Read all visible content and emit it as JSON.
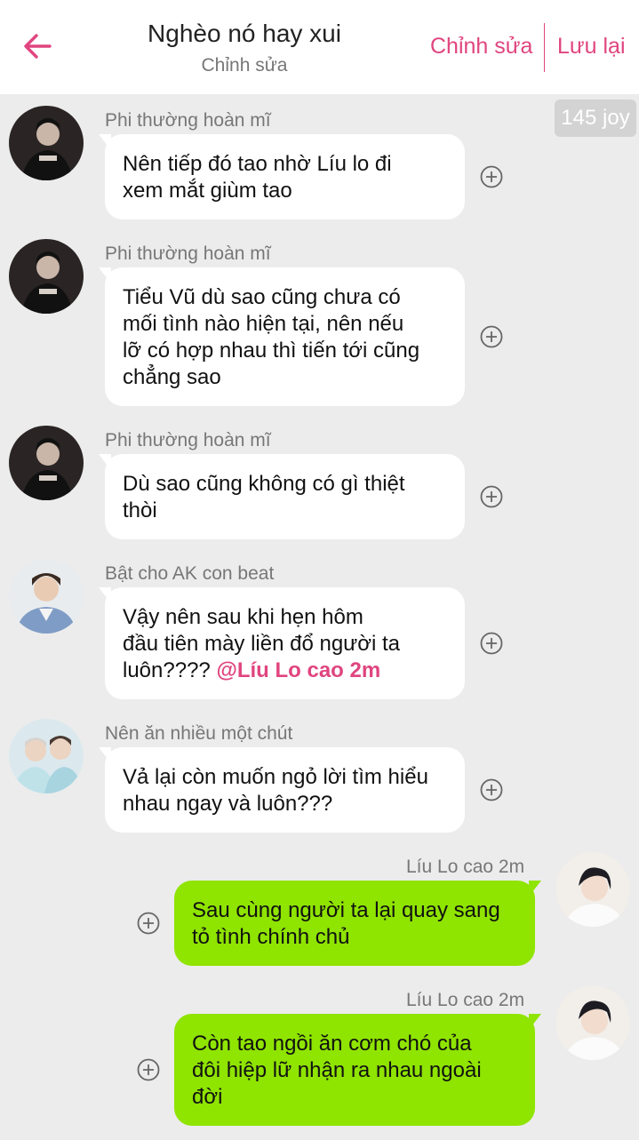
{
  "header": {
    "title": "Nghèo nó hay xui",
    "subtitle": "Chỉnh sửa",
    "edit_label": "Chỉnh sửa",
    "save_label": "Lưu lại",
    "back_icon": "arrow-left-icon",
    "accent_color": "#e0457f"
  },
  "joy_badge": "145 joy",
  "messages": [
    {
      "sender": "Phi thường hoàn mĩ",
      "side": "left",
      "lines": [
        "Nên tiếp đó tao nhờ Líu lo đi",
        "xem mắt giùm tao"
      ]
    },
    {
      "sender": "Phi thường hoàn mĩ",
      "side": "left",
      "lines": [
        "Tiểu Vũ dù sao cũng chưa có",
        "mối tình nào hiện tại, nên nếu",
        "lỡ có hợp nhau thì tiến tới cũng",
        "chẳng sao"
      ]
    },
    {
      "sender": "Phi thường hoàn mĩ",
      "side": "left",
      "lines": [
        "Dù sao cũng không có gì thiệt",
        "thòi"
      ]
    },
    {
      "sender": "Bật cho AK con beat",
      "side": "left",
      "lines": [
        "Vậy nên sau khi hẹn hôm",
        "đầu tiên mày liền đổ người ta",
        "luôn????"
      ],
      "mention": "@Líu Lo cao 2m"
    },
    {
      "sender": "Nên ăn nhiều một chút",
      "side": "left",
      "lines": [
        "Vả lại còn muốn ngỏ lời tìm hiểu",
        "nhau ngay và luôn???"
      ]
    },
    {
      "sender": "Líu Lo cao 2m",
      "side": "right",
      "lines": [
        "Sau cùng người ta lại quay sang",
        "tỏ tình chính chủ"
      ]
    },
    {
      "sender": "Líu Lo cao 2m",
      "side": "right",
      "lines": [
        "Còn tao ngồi ăn cơm chó của",
        "đôi hiệp lữ nhận ra nhau ngoài",
        "đời"
      ]
    }
  ],
  "colors": {
    "background": "#ececec",
    "bubble_left": "#ffffff",
    "bubble_right": "#8fe400"
  },
  "icons": {
    "add": "plus-circle-icon",
    "avatar": "avatar"
  }
}
